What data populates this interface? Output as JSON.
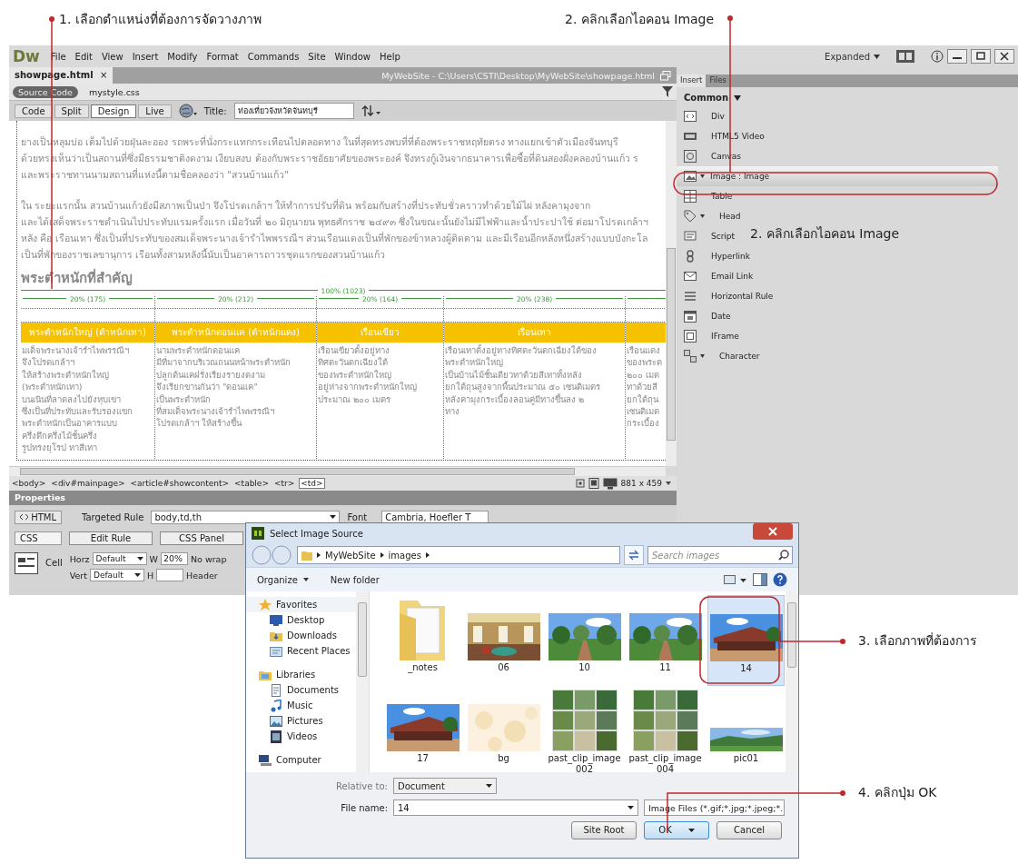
{
  "annotations": [
    {
      "text": "1. เลือกตำแหน่งที่ต้องการจัดวางภาพ"
    },
    {
      "text": "2. คลิกเลือกไอคอน Image"
    },
    {
      "text": "2. คลิกเลือกไอคอน Image"
    },
    {
      "text": "3. เลือกภาพที่ต้องการ"
    },
    {
      "text": "4. คลิกปุ่ม OK"
    }
  ],
  "editor": {
    "logo": "Dw",
    "menu": [
      "File",
      "Edit",
      "View",
      "Insert",
      "Modify",
      "Format",
      "Commands",
      "Site",
      "Window",
      "Help"
    ],
    "workspace": "Expanded",
    "document_tab": "showpage.html",
    "tab_close": "×",
    "window_path": "MyWebSite - C:\\Users\\CSTI\\Desktop\\MyWebSite\\showpage.html",
    "related_files": [
      {
        "label": "Source Code",
        "selected": true
      },
      {
        "label": "mystyle.css",
        "selected": false
      }
    ],
    "view_buttons": [
      {
        "label": "Code",
        "selected": false
      },
      {
        "label": "Split",
        "selected": false
      },
      {
        "label": "Design",
        "selected": true
      },
      {
        "label": "Live",
        "selected": false
      }
    ],
    "title_label": "Title:",
    "title_value": "ท่องเที่ยวจังหวัดจันทบุรี",
    "document": {
      "paragraphs": [
        [
          "ยางเป็นหลุมบ่อ เต็มไปด้วยฝุ่นละออง รถพระที่นั่งกระแทกกระเทือนไปตลอดทาง ในที่สุดทรงพบที่ที่ต้องพระราชหฤทัยตรง ทางแยกเข้าตัวเมืองจันทบุรี",
          "ด้วยทรงเห็นว่าเป็นสถานที่ซึ่งมีธรรมชาติงดงาม เงียบสงบ ต้องกับพระราชอัธยาศัยของพระองค์ จึงทรงกู้เงินจากธนาคารเพื่อซื้อที่ดินสองฝั่งคลองบ้านแก้ว ร",
          "และพระราชทานนามสถานที่แห่งนี้ตามชื่อคลองว่า \"สวนบ้านแก้ว\""
        ],
        [
          "ใน ระยะแรกนั้น สวนบ้านแก้วยังมีสภาพเป็นป่า จึงโปรดเกล้าฯ ให้ทำการปรับที่ดิน พร้อมกับสร้างที่ประทับชั่วคราวทำด้วยไม้ไผ่ หลังคามุงจาก",
          "และได้เสด็จพระราชดำเนินไปประทับแรมครั้งแรก เมื่อวันที่ ๒๐ มิถุนายน พุทธศักราช ๒๔๙๓ ซึ่งในขณะนั้นยังไม่มีไฟฟ้าและน้ำประปาใช้ ต่อมาโปรดเกล้าฯ",
          "หลัง คือ เรือนเทา ซึ่งเป็นที่ประทับของสมเด็จพระนางเจ้ารำไพพรรณีฯ ส่วนเรือนแดงเป็นที่พักของข้าหลวงผู้ติดตาม และมีเรือนอีกหลังหนึ่งสร้างแบบบังกะโล",
          "เป็นที่พักของราชเลขานุการ เรือนทั้งสามหลังนี้นับเป็นอาคารถาวรชุดแรกของสวนบ้านแก้ว"
        ]
      ],
      "heading": "พระตำหนักที่สำคัญ",
      "table_width": "100% (1023)",
      "columns": [
        {
          "width": "20% (175)",
          "header": "พระตำหนักใหญ่ (ตำหนักเทา)",
          "lines": [
            "มเด็จพระนางเจ้ารำไพพรรณีฯ",
            "จึงโปรดเกล้าฯ",
            "ให้สร้างพระตำหนักใหญ่",
            "(พระตำหนักเทา)",
            "บนเนินที่ลาดลงไปยังหุบเขา",
            "ซึ่งเป็นที่ประทับและรับรองแขก",
            "พระตำหนักเป็นอาคารแบบ",
            "ครึ่งตึกครึ่งไม้ชั้นครึ่ง",
            "รูปทรงยุโรป ทาสีเทา"
          ]
        },
        {
          "width": "20% (212)",
          "header": "พระตำหนักดอนแค (ตำหนักแดง)",
          "lines": [
            "นามพระตำหนักดอนแค",
            "มีที่มาจากบริเวณถนนหน้าพระตำหนัก",
            "ปลูกต้นแคฝรั่งเรียงรายงดงาม",
            "จึงเรียกขานกันว่า \"ดอนแค\"",
            "เป็นพระตำหนัก",
            "ที่สมเด็จพระนางเจ้ารำไพพรรณีฯ",
            "โปรดเกล้าฯ ให้สร้างขึ้น"
          ]
        },
        {
          "width": "20% (164)",
          "header": "เรือนเขียว",
          "lines": [
            "เรือนเขียวตั้งอยู่ทาง",
            "ทิศตะวันตกเฉียงใต้",
            "ของพระตำหนักใหญ่",
            "อยู่ห่างจากพระตำหนักใหญ่",
            "ประมาณ ๒๐๐ เมตร"
          ]
        },
        {
          "width": "20% (238)",
          "header": "เรือนเทา",
          "lines": [
            "เรือนเทาตั้งอยู่ทางทิศตะวันตกเฉียงใต้ของ",
            "พระตำหนักใหญ่",
            "เป็นบ้านไม้ชั้นเดียวทาด้วยสีเทาทั้งหลัง",
            "ยกใต้ถุนสูงจากพื้นประมาณ ๕๐ เซนติเมตร",
            "หลังคามุงกระเบื้องลอนคู่มีทางขึ้นลง ๒",
            "ทาง"
          ]
        },
        {
          "lines": [
            "เรือนแดง",
            "ของพระต",
            "๒๐๐ เมต",
            "ทาด้วยสี",
            "ยกใต้ถุน",
            "เซนติเมต",
            "กระเบื้อง"
          ]
        }
      ]
    },
    "tag_selector": [
      {
        "label": "<body>",
        "selected": false
      },
      {
        "label": "<div#mainpage>",
        "selected": false
      },
      {
        "label": "<article#showcontent>",
        "selected": false
      },
      {
        "label": "<table>",
        "selected": false
      },
      {
        "label": "<tr>",
        "selected": false
      },
      {
        "label": "<td>",
        "selected": true
      }
    ],
    "window_size": "881 x 459",
    "properties": {
      "title": "Properties",
      "html_label": "HTML",
      "css_label": "CSS",
      "targeted_rule_label": "Targeted Rule",
      "targeted_rule": "body,td,th",
      "edit_rule": "Edit Rule",
      "css_panel": "CSS Panel",
      "font_label": "Font",
      "font_value": "Cambria, Hoefler T",
      "cell_label": "Cell",
      "horz_label": "Horz",
      "horz_value": "Default",
      "w_label": "W",
      "w_value": "20%",
      "nowrap_label": "No wrap",
      "vert_label": "Vert",
      "vert_value": "Default",
      "h_label": "H",
      "header_label": "Header"
    },
    "panel": {
      "tabs": [
        {
          "label": "Insert",
          "selected": true
        },
        {
          "label": "Files",
          "selected": false
        }
      ],
      "category": "Common",
      "items": [
        {
          "label": "Div",
          "dropdown": false,
          "selected": false
        },
        {
          "label": "HTML5 Video",
          "dropdown": false,
          "selected": false
        },
        {
          "label": "Canvas",
          "dropdown": false,
          "selected": false
        },
        {
          "label": "Image : Image",
          "dropdown": true,
          "selected": true
        },
        {
          "label": "Table",
          "dropdown": false,
          "selected": false
        },
        {
          "label": "Head",
          "dropdown": true,
          "selected": false
        },
        {
          "label": "Script",
          "dropdown": false,
          "selected": false
        },
        {
          "label": "Hyperlink",
          "dropdown": false,
          "selected": false
        },
        {
          "label": "Email Link",
          "dropdown": false,
          "selected": false
        },
        {
          "label": "Horizontal Rule",
          "dropdown": false,
          "selected": false
        },
        {
          "label": "Date",
          "dropdown": false,
          "selected": false
        },
        {
          "label": "IFrame",
          "dropdown": false,
          "selected": false
        },
        {
          "label": "Character",
          "dropdown": true,
          "selected": false
        }
      ]
    }
  },
  "dialog": {
    "title": "Select Image Source",
    "breadcrumb": [
      "MyWebSite",
      "images"
    ],
    "search_placeholder": "Search images",
    "toolbar": [
      "Organize",
      "New folder"
    ],
    "nav": [
      {
        "label": "Favorites",
        "kind": "group"
      },
      {
        "label": "Desktop",
        "kind": "item"
      },
      {
        "label": "Downloads",
        "kind": "item"
      },
      {
        "label": "Recent Places",
        "kind": "item"
      },
      {
        "label": "Libraries",
        "kind": "group"
      },
      {
        "label": "Documents",
        "kind": "item"
      },
      {
        "label": "Music",
        "kind": "item"
      },
      {
        "label": "Pictures",
        "kind": "item"
      },
      {
        "label": "Videos",
        "kind": "item"
      },
      {
        "label": "Computer",
        "kind": "group"
      }
    ],
    "files": [
      {
        "label": "_notes",
        "kind": "folder",
        "selected": false
      },
      {
        "label": "06",
        "kind": "picture",
        "selected": false
      },
      {
        "label": "10",
        "kind": "picture",
        "selected": false
      },
      {
        "label": "11",
        "kind": "picture",
        "selected": false
      },
      {
        "label": "14",
        "kind": "picture",
        "selected": true
      },
      {
        "label": "17",
        "kind": "picture",
        "selected": false
      },
      {
        "label": "bg",
        "kind": "picture",
        "selected": false
      },
      {
        "label": "past_clip_image002",
        "kind": "picture",
        "selected": false
      },
      {
        "label": "past_clip_image004",
        "kind": "picture",
        "selected": false
      },
      {
        "label": "pic01",
        "kind": "picture",
        "selected": false
      }
    ],
    "relative_label": "Relative to:",
    "relative_value": "Document",
    "filename_label": "File name:",
    "filename_value": "14",
    "filter": "Image Files (*.gif;*.jpg;*.jpeg;*.",
    "buttons": [
      {
        "label": "Site Root",
        "default": false
      },
      {
        "label": "OK",
        "default": true
      },
      {
        "label": "Cancel",
        "default": false
      }
    ]
  }
}
